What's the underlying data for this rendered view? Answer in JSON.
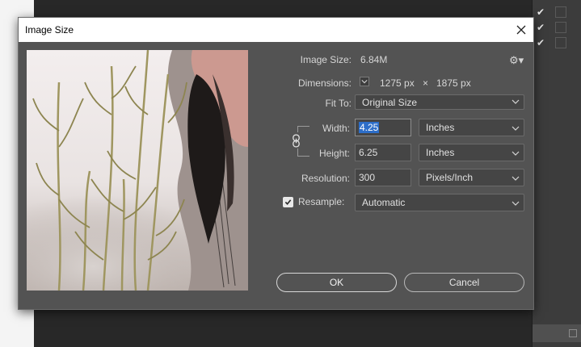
{
  "dialog": {
    "title": "Image Size"
  },
  "image_size": {
    "label": "Image Size:",
    "value": "6.84M"
  },
  "dimensions": {
    "label": "Dimensions:",
    "width_value": "1275 px",
    "separator": "×",
    "height_value": "1875 px"
  },
  "fit_to": {
    "label": "Fit To:",
    "selected": "Original Size"
  },
  "width": {
    "label": "Width:",
    "value": "4.25",
    "unit": "Inches"
  },
  "height": {
    "label": "Height:",
    "value": "6.25",
    "unit": "Inches"
  },
  "resolution": {
    "label": "Resolution:",
    "value": "300",
    "unit": "Pixels/Inch"
  },
  "resample": {
    "label": "Resample:",
    "checked": true,
    "selected": "Automatic"
  },
  "buttons": {
    "ok": "OK",
    "cancel": "Cancel"
  },
  "icons": {
    "close": "close-icon",
    "gear": "gear-icon",
    "chain": "link-icon",
    "chevron": "chevron-down-icon"
  },
  "colors": {
    "dialog_bg": "#535353",
    "titlebar_bg": "#ffffff",
    "selection": "#2d6ec9"
  }
}
